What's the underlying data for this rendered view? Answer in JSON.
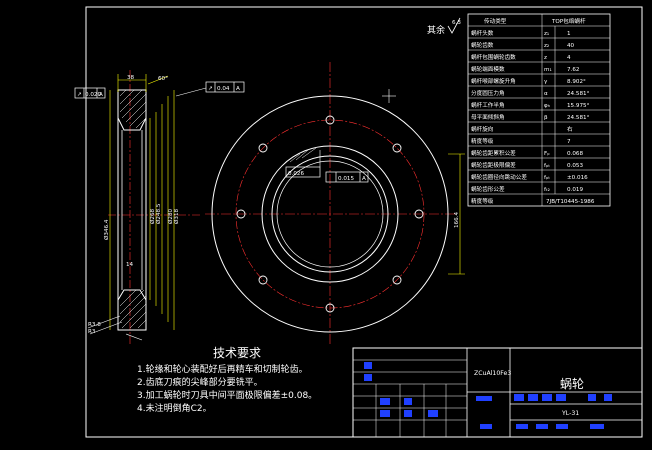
{
  "drawing": {
    "surface_roughness": {
      "label": "其余",
      "value": "6.3"
    },
    "gear_param_table": {
      "header": [
        "传动类型",
        "TOP包络蜗杆"
      ],
      "rows": [
        {
          "name": "蜗杆头数",
          "symbol": "z₁",
          "value": "1"
        },
        {
          "name": "蜗轮齿数",
          "symbol": "z₂",
          "value": "40"
        },
        {
          "name": "蜗杆包围蜗轮齿数",
          "symbol": "z",
          "value": "4"
        },
        {
          "name": "蜗轮端面模数",
          "symbol": "m₁",
          "value": "7.62"
        },
        {
          "name": "蜗杆喉部螺旋升角",
          "symbol": "γ",
          "value": "8.902°"
        },
        {
          "name": "分度圆压力角",
          "symbol": "α",
          "value": "24.581°"
        },
        {
          "name": "蜗杆工作半角",
          "symbol": "φₕ",
          "value": "15.975°"
        },
        {
          "name": "母平面倾斜角",
          "symbol": "β",
          "value": "24.581°"
        },
        {
          "name": "蜗杆旋向",
          "symbol": "",
          "value": "右"
        },
        {
          "name": "精度等级",
          "symbol": "",
          "value": "7"
        },
        {
          "name": "蜗轮齿距累积公差",
          "symbol": "Fₚ",
          "value": "0.068"
        },
        {
          "name": "蜗轮齿距极限偏差",
          "symbol": "fₚₜ",
          "value": "0.053"
        },
        {
          "name": "蜗轮齿圈径向跳动公差",
          "symbol": "fₚₜ",
          "value": "±0.016"
        },
        {
          "name": "蜗轮齿形公差",
          "symbol": "fₜ₂",
          "value": "0.019"
        },
        {
          "name": "精度等级",
          "symbol": "",
          "value": "7JB/T10445-1986"
        }
      ]
    },
    "tolerances": {
      "runout_left": {
        "symbol": "↗",
        "value": "0.020",
        "datum": "A"
      },
      "runout_top": {
        "symbol": "↗",
        "value": "0.04",
        "datum": "A"
      },
      "bore_tol_1": {
        "value": "0.026"
      },
      "bore_tol_2": {
        "value": "0.015",
        "datum": "A"
      }
    },
    "dimensions": {
      "top_width": "38",
      "angle": "60°",
      "d1": "Ø346.4",
      "d2": "Ø268",
      "d3": "Ø248.5",
      "d4": "Ø280",
      "d5": "Ø318",
      "bottom_h": "14",
      "chamfer": "R3.8",
      "chamfer2": "R3",
      "right_h": "166.4"
    },
    "tech_requirements": {
      "title": "技术要求",
      "items": [
        "1.轮缘和轮心装配好后再精车和切制轮齿。",
        "2.齿底刀痕的尖峰部分要铣平。",
        "3.加工蜗轮时刀具中间平面极限偏差±0.08。",
        "4.未注明倒角C2。"
      ]
    },
    "title_block": {
      "material": "ZCuAl10Fe3",
      "part_name": "蜗轮",
      "drawing_no": "YL-31"
    }
  }
}
